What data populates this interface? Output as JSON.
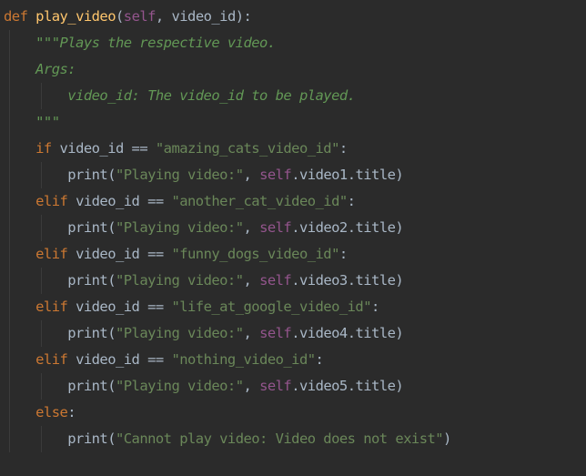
{
  "editor": {
    "lines": [
      [
        {
          "t": "def",
          "c": "kw"
        },
        {
          "t": " ",
          "c": "plain"
        },
        {
          "t": "play_video",
          "c": "fn"
        },
        {
          "t": "(",
          "c": "plain"
        },
        {
          "t": "self",
          "c": "self"
        },
        {
          "t": ", video_id):",
          "c": "plain"
        }
      ],
      [
        {
          "t": "    ",
          "c": "plain"
        },
        {
          "t": "\"\"\"Plays the respective video.",
          "c": "doc"
        }
      ],
      [
        {
          "t": "    ",
          "c": "plain"
        },
        {
          "t": "Args:",
          "c": "doc"
        }
      ],
      [
        {
          "t": "        ",
          "c": "plain"
        },
        {
          "t": "video_id: The video_id to be played.",
          "c": "doc"
        }
      ],
      [
        {
          "t": "    ",
          "c": "plain"
        },
        {
          "t": "\"\"\"",
          "c": "doc"
        }
      ],
      [
        {
          "t": "    ",
          "c": "plain"
        },
        {
          "t": "if",
          "c": "kw"
        },
        {
          "t": " video_id == ",
          "c": "plain"
        },
        {
          "t": "\"amazing_cats_video_id\"",
          "c": "str"
        },
        {
          "t": ":",
          "c": "plain"
        }
      ],
      [
        {
          "t": "        ",
          "c": "plain"
        },
        {
          "t": "print",
          "c": "bi"
        },
        {
          "t": "(",
          "c": "plain"
        },
        {
          "t": "\"Playing video:\"",
          "c": "str"
        },
        {
          "t": ", ",
          "c": "plain"
        },
        {
          "t": "self",
          "c": "self"
        },
        {
          "t": ".video1.title)",
          "c": "plain"
        }
      ],
      [
        {
          "t": "    ",
          "c": "plain"
        },
        {
          "t": "elif",
          "c": "kw"
        },
        {
          "t": " video_id == ",
          "c": "plain"
        },
        {
          "t": "\"another_cat_video_id\"",
          "c": "str"
        },
        {
          "t": ":",
          "c": "plain"
        }
      ],
      [
        {
          "t": "        ",
          "c": "plain"
        },
        {
          "t": "print",
          "c": "bi"
        },
        {
          "t": "(",
          "c": "plain"
        },
        {
          "t": "\"Playing video:\"",
          "c": "str"
        },
        {
          "t": ", ",
          "c": "plain"
        },
        {
          "t": "self",
          "c": "self"
        },
        {
          "t": ".video2.title)",
          "c": "plain"
        }
      ],
      [
        {
          "t": "    ",
          "c": "plain"
        },
        {
          "t": "elif",
          "c": "kw"
        },
        {
          "t": " video_id == ",
          "c": "plain"
        },
        {
          "t": "\"funny_dogs_video_id\"",
          "c": "str"
        },
        {
          "t": ":",
          "c": "plain"
        }
      ],
      [
        {
          "t": "        ",
          "c": "plain"
        },
        {
          "t": "print",
          "c": "bi"
        },
        {
          "t": "(",
          "c": "plain"
        },
        {
          "t": "\"Playing video:\"",
          "c": "str"
        },
        {
          "t": ", ",
          "c": "plain"
        },
        {
          "t": "self",
          "c": "self"
        },
        {
          "t": ".video3.title)",
          "c": "plain"
        }
      ],
      [
        {
          "t": "    ",
          "c": "plain"
        },
        {
          "t": "elif",
          "c": "kw"
        },
        {
          "t": " video_id == ",
          "c": "plain"
        },
        {
          "t": "\"life_at_google_video_id\"",
          "c": "str"
        },
        {
          "t": ":",
          "c": "plain"
        }
      ],
      [
        {
          "t": "        ",
          "c": "plain"
        },
        {
          "t": "print",
          "c": "bi"
        },
        {
          "t": "(",
          "c": "plain"
        },
        {
          "t": "\"Playing video:\"",
          "c": "str"
        },
        {
          "t": ", ",
          "c": "plain"
        },
        {
          "t": "self",
          "c": "self"
        },
        {
          "t": ".video4.title)",
          "c": "plain"
        }
      ],
      [
        {
          "t": "    ",
          "c": "plain"
        },
        {
          "t": "elif",
          "c": "kw"
        },
        {
          "t": " video_id == ",
          "c": "plain"
        },
        {
          "t": "\"nothing_video_id\"",
          "c": "str"
        },
        {
          "t": ":",
          "c": "plain"
        }
      ],
      [
        {
          "t": "        ",
          "c": "plain"
        },
        {
          "t": "print",
          "c": "bi"
        },
        {
          "t": "(",
          "c": "plain"
        },
        {
          "t": "\"Playing video:\"",
          "c": "str"
        },
        {
          "t": ", ",
          "c": "plain"
        },
        {
          "t": "self",
          "c": "self"
        },
        {
          "t": ".video5.title)",
          "c": "plain"
        }
      ],
      [
        {
          "t": "    ",
          "c": "plain"
        },
        {
          "t": "else",
          "c": "kw"
        },
        {
          "t": ":",
          "c": "plain"
        }
      ],
      [
        {
          "t": "        ",
          "c": "plain"
        },
        {
          "t": "print",
          "c": "bi"
        },
        {
          "t": "(",
          "c": "plain"
        },
        {
          "t": "\"Cannot play video: Video does not exist\"",
          "c": "str"
        },
        {
          "t": ")",
          "c": "plain"
        }
      ]
    ]
  },
  "theme": {
    "background": "#2b2b2b",
    "keyword": "#cc7832",
    "function_name": "#ffc66d",
    "self": "#94558d",
    "string": "#6a8759",
    "docstring": "#629755",
    "text": "#a9b7c6"
  }
}
